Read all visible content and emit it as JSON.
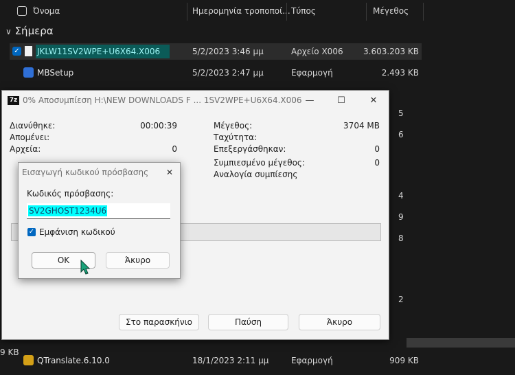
{
  "explorer": {
    "columns": {
      "name": "Όνομα",
      "date": "Ημερομηνία τροποποί...",
      "type": "Τύπος",
      "size": "Μέγεθος"
    },
    "group_today": "Σήμερα",
    "files": [
      {
        "name": "JKLW11SV2WPE+U6X64.X006",
        "date": "5/2/2023 3:46 μμ",
        "type": "Αρχείο X006",
        "size": "3.603.203 KB"
      },
      {
        "name": "MBSetup",
        "date": "5/2/2023 2:47 μμ",
        "type": "Εφαρμογή",
        "size": "2.493 KB"
      },
      {
        "name": "QTranslate.6.10.0",
        "date": "18/1/2023 2:11 μμ",
        "type": "Εφαρμογή",
        "size": "909 KB"
      }
    ],
    "partial_right": [
      "5",
      "6",
      "4",
      "9",
      "8",
      "2"
    ],
    "partial_left": "9 KB"
  },
  "extract_window": {
    "logo": "7z",
    "title": "0% Αποσυμπίεση H:\\NEW DOWNLOADS F ... 1SV2WPE+U6X64.X006",
    "elapsed_label": "Διανύθηκε:",
    "elapsed_value": "00:00:39",
    "remaining_label": "Απομένει:",
    "files_label": "Αρχεία:",
    "files_value": "0",
    "size_label": "Μέγεθος:",
    "size_value": "3704 MB",
    "speed_label": "Ταχύτητα:",
    "processed_label": "Επεξεργάσθηκαν:",
    "processed_value": "0",
    "compressed_label": "Συμπιεσμένο μέγεθος:",
    "compressed_value": "0",
    "ratio_label": "Αναλογία συμπίεσης",
    "progress": 0,
    "background_button": "Στο παρασκήνιο",
    "pause_button": "Παύση",
    "cancel_button": "Άκυρο"
  },
  "password_dialog": {
    "title": "Εισαγωγή κωδικού πρόσβασης",
    "field_label": "Κωδικός πρόσβασης:",
    "password_value": "SV2GHOST1234U6",
    "show_password_label": "Εμφάνιση κωδικού",
    "show_password_checked": true,
    "ok_button": "OK",
    "cancel_button": "Άκυρο"
  }
}
